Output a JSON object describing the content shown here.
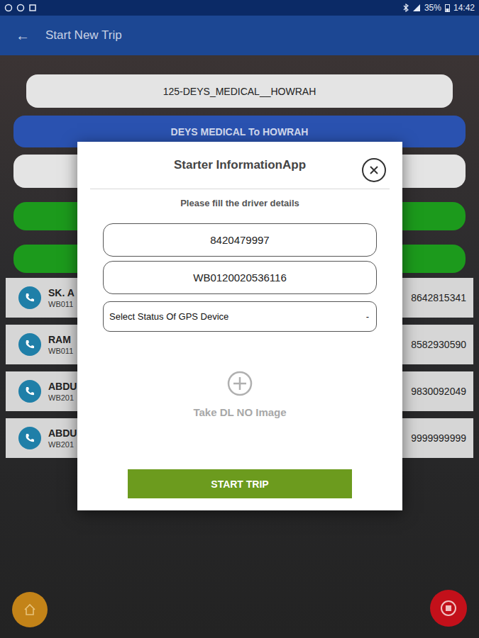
{
  "status_bar": {
    "battery": "35%",
    "time": "14:42"
  },
  "app_bar": {
    "back": "←",
    "title": "Start New Trip"
  },
  "route": {
    "code": "125-DEYS_MEDICAL__HOWRAH",
    "direction": "DEYS MEDICAL  To HOWRAH"
  },
  "drivers": [
    {
      "name": "SK. A",
      "licence": "WB011",
      "phone": "8642815341"
    },
    {
      "name": "RAM",
      "licence": "WB011",
      "phone": "8582930590"
    },
    {
      "name": "ABDU",
      "licence": "WB201",
      "phone": "9830092049"
    },
    {
      "name": "ABDU",
      "licence": "WB201",
      "phone": "9999999999"
    }
  ],
  "dialog": {
    "title": "Starter InformationApp",
    "prompt": "Please fill the driver details",
    "phone": "8420479997",
    "licence": "WB0120020536116",
    "gps_select": "Select Status Of GPS Device",
    "select_arrow": "-",
    "image_label": "Take DL NO Image",
    "button": "START TRIP"
  }
}
